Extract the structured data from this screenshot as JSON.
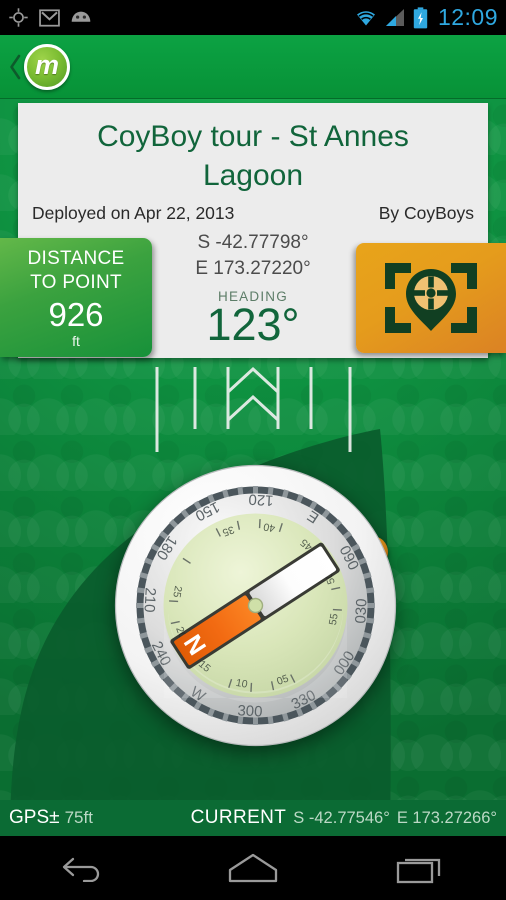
{
  "statusbar": {
    "icons": [
      "gps-fix-icon",
      "gmail-icon",
      "android-icon"
    ],
    "wifi_icon": "wifi-icon",
    "signal_icon": "cell-signal-icon",
    "battery_icon": "battery-charging-icon",
    "clock": "12:09",
    "clock_color": "#2fa8e0"
  },
  "actionbar": {
    "back_icon": "back-chevron-icon",
    "logo_letter": "m",
    "background_color": "#0a9b40"
  },
  "card": {
    "title": "CoyBoy tour - St Annes Lagoon",
    "deployed": "Deployed on Apr 22, 2013",
    "author": "By CoyBoys",
    "latitude": "S -42.77798°",
    "longitude": "E 173.27220°",
    "heading_label": "HEADING",
    "heading_value": "123°",
    "title_color": "#11653b"
  },
  "distance_panel": {
    "line1": "DISTANCE",
    "line2": "TO POINT",
    "value": "926",
    "unit": "ft",
    "color": "#3ba23f"
  },
  "locate_button": {
    "icon": "pin-crosshair-frame-icon",
    "color": "#e59c1c"
  },
  "compass": {
    "outer_bearings": [
      "000",
      "030",
      "060",
      "120",
      "150",
      "180",
      "210",
      "240",
      "300",
      "330"
    ],
    "cardinals": [
      "E",
      "W"
    ],
    "inner_ticks": [
      "05",
      "10",
      "15",
      "20",
      "25",
      "35",
      "40",
      "45",
      "50",
      "55"
    ],
    "needle_north_letter": "N",
    "needle_color": "#f26a12",
    "rotation_degrees": 123
  },
  "gps_bar": {
    "accuracy_label": "GPS±",
    "accuracy_value": "75ft",
    "current_label": "CURRENT",
    "current_lat": "S -42.77546°",
    "current_lon": "E 173.27266°"
  },
  "navbar": {
    "back": "back-nav-icon",
    "home": "home-nav-icon",
    "recents": "recents-nav-icon"
  }
}
